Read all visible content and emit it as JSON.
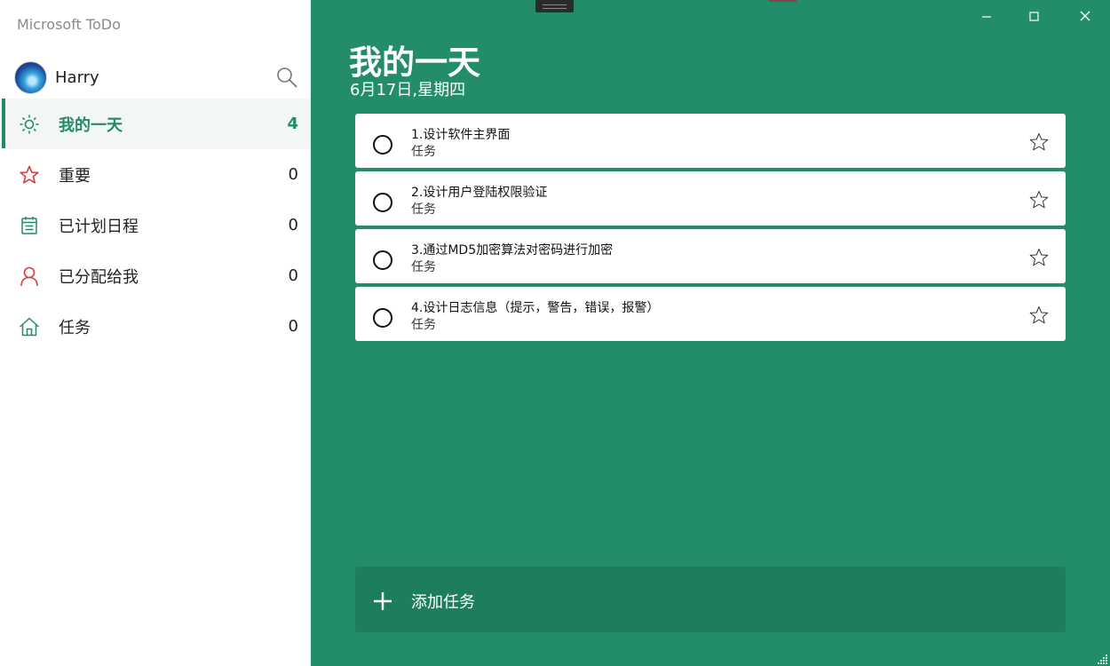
{
  "app": {
    "title": "Microsoft ToDo"
  },
  "user": {
    "name": "Harry"
  },
  "nav": {
    "items": [
      {
        "label": "我的一天",
        "count": "4",
        "icon": "sun-icon",
        "active": true
      },
      {
        "label": "重要",
        "count": "0",
        "icon": "star-icon"
      },
      {
        "label": "已计划日程",
        "count": "0",
        "icon": "calendar-icon"
      },
      {
        "label": "已分配给我",
        "count": "0",
        "icon": "person-icon"
      },
      {
        "label": "任务",
        "count": "0",
        "icon": "home-icon"
      }
    ]
  },
  "main": {
    "title": "我的一天",
    "date": "6月17日,星期四",
    "tasks": [
      {
        "title": "1.设计软件主界面",
        "list": "任务"
      },
      {
        "title": "2.设计用户登陆权限验证",
        "list": "任务"
      },
      {
        "title": "3.通过MD5加密算法对密码进行加密",
        "list": "任务"
      },
      {
        "title": "4.设计日志信息（提示，警告，错误，报警）",
        "list": "任务"
      }
    ],
    "add_task_label": "添加任务"
  },
  "colors": {
    "accent": "#23896a",
    "main_bg": "#238c6b",
    "add_bg": "#1f7d5f",
    "important_red": "#d83b3b"
  }
}
